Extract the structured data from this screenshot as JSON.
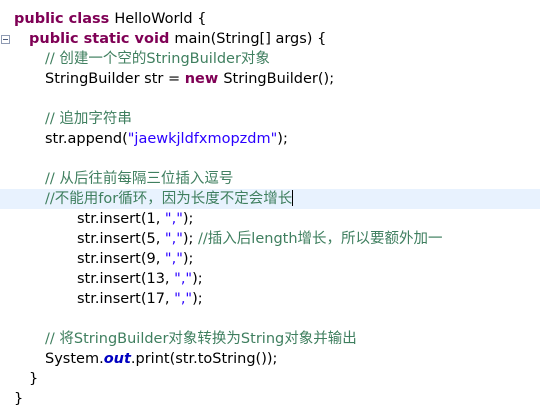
{
  "editor": {
    "lines": [
      {
        "indent": 0,
        "tokens": [
          {
            "t": "public class ",
            "c": "kw"
          },
          {
            "t": "HelloWorld {",
            "c": ""
          }
        ]
      },
      {
        "indent": 1,
        "fold": true,
        "tokens": [
          {
            "t": "public static void ",
            "c": "kw"
          },
          {
            "t": "main(String[] args) {",
            "c": ""
          }
        ]
      },
      {
        "indent": 2,
        "tokens": [
          {
            "t": "// 创建一个空的StringBuilder对象",
            "c": "cmt"
          }
        ]
      },
      {
        "indent": 2,
        "tokens": [
          {
            "t": "StringBuilder str = ",
            "c": ""
          },
          {
            "t": "new ",
            "c": "kw"
          },
          {
            "t": "StringBuilder();",
            "c": ""
          }
        ]
      },
      {
        "indent": 0,
        "tokens": []
      },
      {
        "indent": 2,
        "tokens": [
          {
            "t": "// 追加字符串",
            "c": "cmt"
          }
        ]
      },
      {
        "indent": 2,
        "tokens": [
          {
            "t": "str.append(",
            "c": ""
          },
          {
            "t": "\"jaewkjldfxmopzdm\"",
            "c": "str"
          },
          {
            "t": ");",
            "c": ""
          }
        ]
      },
      {
        "indent": 0,
        "tokens": []
      },
      {
        "indent": 2,
        "tokens": [
          {
            "t": "// 从后往前每隔三位插入逗号",
            "c": "cmt"
          }
        ]
      },
      {
        "indent": 2,
        "current": true,
        "tokens": [
          {
            "t": "//不能用for循环，因为长度不定会增长",
            "c": "cmt"
          }
        ]
      },
      {
        "indent": 4,
        "tokens": [
          {
            "t": "str.insert(1, ",
            "c": ""
          },
          {
            "t": "\",\"",
            "c": "str"
          },
          {
            "t": ");",
            "c": ""
          }
        ]
      },
      {
        "indent": 4,
        "tokens": [
          {
            "t": "str.insert(5, ",
            "c": ""
          },
          {
            "t": "\",\"",
            "c": "str"
          },
          {
            "t": "); ",
            "c": ""
          },
          {
            "t": "//插入后length增长，所以要额外加一",
            "c": "cmt"
          }
        ]
      },
      {
        "indent": 4,
        "tokens": [
          {
            "t": "str.insert(9, ",
            "c": ""
          },
          {
            "t": "\",\"",
            "c": "str"
          },
          {
            "t": ");",
            "c": ""
          }
        ]
      },
      {
        "indent": 4,
        "tokens": [
          {
            "t": "str.insert(13, ",
            "c": ""
          },
          {
            "t": "\",\"",
            "c": "str"
          },
          {
            "t": ");",
            "c": ""
          }
        ]
      },
      {
        "indent": 4,
        "tokens": [
          {
            "t": "str.insert(17, ",
            "c": ""
          },
          {
            "t": "\",\"",
            "c": "str"
          },
          {
            "t": ");",
            "c": ""
          }
        ]
      },
      {
        "indent": 0,
        "tokens": []
      },
      {
        "indent": 2,
        "tokens": [
          {
            "t": "// 将StringBuilder对象转换为String对象并输出",
            "c": "cmt"
          }
        ]
      },
      {
        "indent": 2,
        "tokens": [
          {
            "t": "System.",
            "c": ""
          },
          {
            "t": "out",
            "c": "field"
          },
          {
            "t": ".print(str.toString());",
            "c": ""
          }
        ]
      },
      {
        "indent": 1,
        "tokens": [
          {
            "t": "}",
            "c": ""
          }
        ]
      },
      {
        "indent": 0,
        "tokens": [
          {
            "t": "}",
            "c": ""
          }
        ]
      }
    ]
  }
}
